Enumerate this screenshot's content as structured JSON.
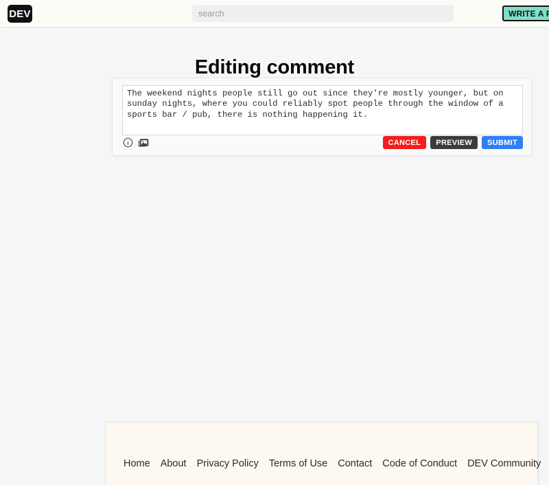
{
  "header": {
    "logo_text": "DEV",
    "search_placeholder": "search",
    "search_value": "",
    "write_post_label": "WRITE A POST"
  },
  "main": {
    "page_title": "Editing comment",
    "editor": {
      "comment_value": "The weekend nights people still go out since they're mostly younger, but on sunday nights, where you could reliably spot people through the window of a sports bar / pub, there is nothing happening it.",
      "comment_placeholder": "",
      "toolbar_icons": [
        {
          "name": "info-icon",
          "glyph": "ⓘ"
        },
        {
          "name": "image-upload-icon",
          "glyph": "🖼"
        }
      ],
      "buttons": {
        "cancel": "CANCEL",
        "preview": "PREVIEW",
        "submit": "SUBMIT"
      }
    }
  },
  "footer": {
    "links": [
      {
        "label": "Home"
      },
      {
        "label": "About"
      },
      {
        "label": "Privacy Policy"
      },
      {
        "label": "Terms of Use"
      },
      {
        "label": "Contact"
      },
      {
        "label": "Code of Conduct"
      },
      {
        "label": "DEV Community"
      }
    ]
  },
  "colors": {
    "page_background": "#f5f6f8",
    "header_background": "#fdfbf6",
    "footer_background": "#fdf9f0",
    "accent_teal": "#7ee0c8",
    "cancel_red": "#f51d1d",
    "preview_dark": "#3b3b3b",
    "submit_blue": "#2f7ef5"
  }
}
